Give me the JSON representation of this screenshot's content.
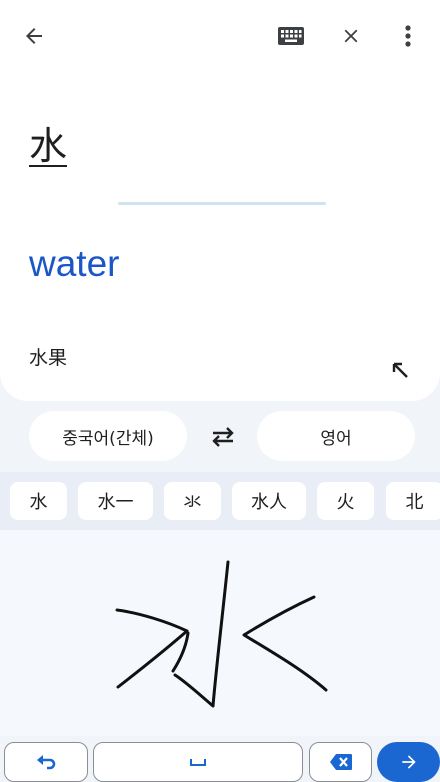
{
  "header": {
    "back_icon": "arrow-back-icon",
    "keyboard_icon": "keyboard-icon",
    "close_icon": "close-icon",
    "more_icon": "more-vert-icon"
  },
  "source": {
    "text": "水"
  },
  "translation": {
    "text": "water"
  },
  "suggestion": {
    "text": "水果"
  },
  "languages": {
    "source": "중국어(간체)",
    "target": "영어"
  },
  "candidates": [
    "水",
    "水一",
    "氺",
    "水人",
    "火",
    "北"
  ],
  "bottom_bar": {
    "undo_icon": "undo-icon",
    "space_icon": "space-bar-icon",
    "backspace_icon": "backspace-icon",
    "go_icon": "arrow-forward-icon"
  },
  "colors": {
    "accent": "#1a67d2",
    "translation_text": "#1a56c8",
    "background": "#f1f4f9"
  }
}
